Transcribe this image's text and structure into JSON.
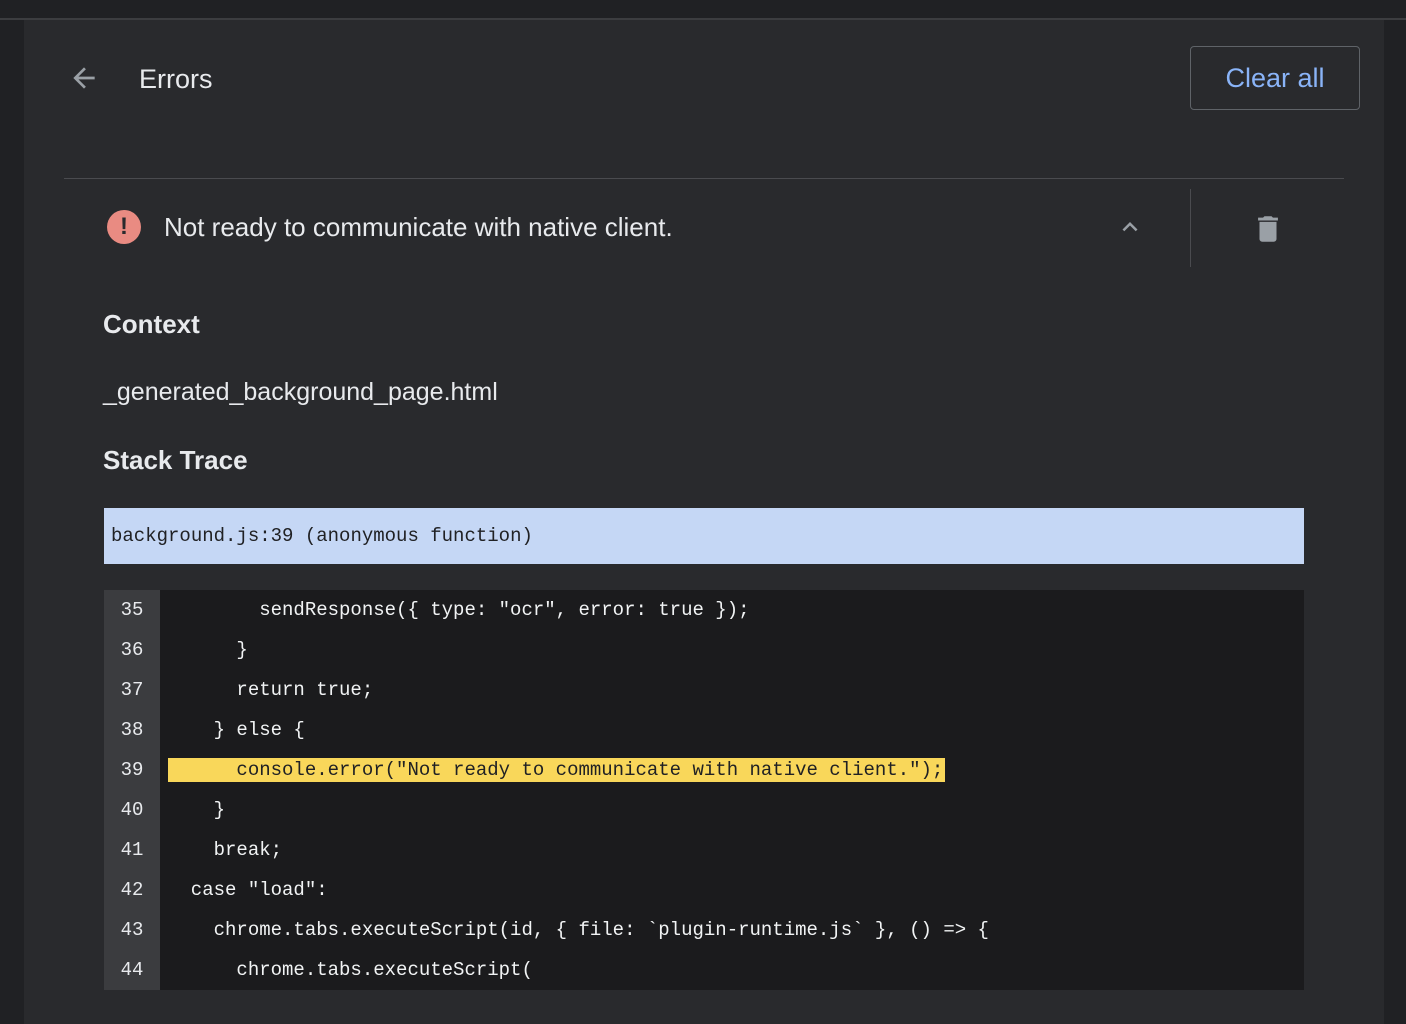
{
  "header": {
    "title": "Errors",
    "clear_all_label": "Clear all"
  },
  "error": {
    "message": "Not ready to communicate with native client."
  },
  "details": {
    "context_heading": "Context",
    "context_value": "_generated_background_page.html",
    "stack_trace_heading": "Stack Trace",
    "stack_frame": "background.js:39 (anonymous function)"
  },
  "code": {
    "highlighted_line": 39,
    "lines": [
      {
        "number": "35",
        "text": "        sendResponse({ type: \"ocr\", error: true });"
      },
      {
        "number": "36",
        "text": "      }"
      },
      {
        "number": "37",
        "text": "      return true;"
      },
      {
        "number": "38",
        "text": "    } else {"
      },
      {
        "number": "39",
        "text": "      console.error(\"Not ready to communicate with native client.\");"
      },
      {
        "number": "40",
        "text": "    }"
      },
      {
        "number": "41",
        "text": "    break;"
      },
      {
        "number": "42",
        "text": "  case \"load\":"
      },
      {
        "number": "43",
        "text": "    chrome.tabs.executeScript(id, { file: `plugin-runtime.js` }, () => {"
      },
      {
        "number": "44",
        "text": "      chrome.tabs.executeScript("
      }
    ]
  },
  "colors": {
    "error_icon": "#e98b82",
    "accent": "#8ab4f8",
    "highlight": "#f9d75a",
    "frame_bar": "#c5d7f5"
  }
}
